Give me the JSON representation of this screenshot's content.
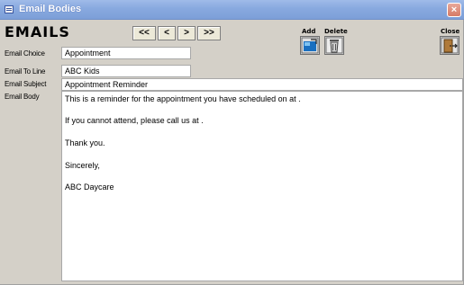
{
  "window": {
    "title": "Email Bodies",
    "close_glyph": "×"
  },
  "heading": "EMAILS",
  "nav": {
    "first": "<<",
    "prev": "<",
    "next": ">",
    "last": ">>"
  },
  "toolbar": {
    "add_label": "Add",
    "delete_label": "Delete",
    "close_label": "Close"
  },
  "form": {
    "email_choice_label": "Email Choice",
    "email_choice_value": "Appointment",
    "email_to_line_label": "Email To Line",
    "email_to_line_value": "ABC Kids",
    "email_subject_label": "Email Subject",
    "email_subject_value": "Appointment Reminder",
    "email_body_label": "Email Body",
    "body_lines": [
      "This is a reminder for the appointment you have scheduled on  at .",
      "If you cannot attend, please call us at  .",
      "Thank you.",
      "Sincerely,",
      "ABC Daycare"
    ]
  },
  "icons": {
    "window": "form-window-icon",
    "add": "add-record-icon",
    "delete": "trash-can-icon",
    "close": "exit-door-icon"
  },
  "colors": {
    "titlebar": "#88a9df",
    "form_background": "#d4d0c8",
    "close_button": "#d67a66",
    "add_icon": "#1a6fc0"
  }
}
